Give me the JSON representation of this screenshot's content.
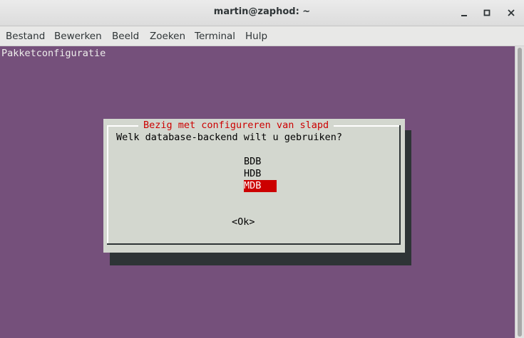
{
  "window": {
    "title": "martin@zaphod: ~"
  },
  "menubar": {
    "items": [
      "Bestand",
      "Bewerken",
      "Beeld",
      "Zoeken",
      "Terminal",
      "Hulp"
    ]
  },
  "terminal": {
    "heading": "Pakketconfiguratie",
    "background_color": "#75507b",
    "dialog": {
      "title": "Bezig met configureren van slapd",
      "question": "Welk database-backend wilt u gebruiken?",
      "options": [
        "BDB",
        "HDB",
        "MDB"
      ],
      "selected_option": "MDB",
      "ok_label": "<Ok>",
      "title_color": "#cc0000",
      "highlight_color": "#cc0000"
    }
  }
}
